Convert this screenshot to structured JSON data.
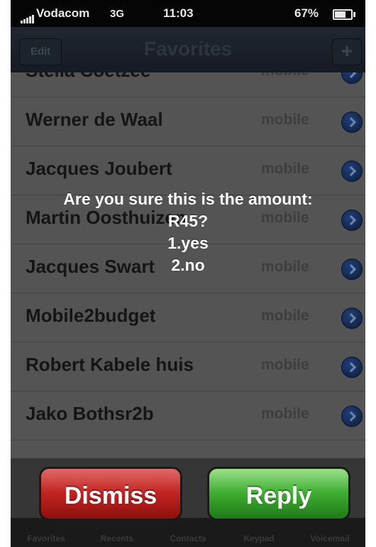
{
  "status_bar": {
    "carrier": "Vodacom",
    "network": "3G",
    "time": "11:03",
    "battery": "67%"
  },
  "nav": {
    "edit_label": "Edit",
    "title": "Favorites",
    "add_label": "+"
  },
  "contacts": [
    {
      "name": "Stella Coetzee",
      "type": "mobile"
    },
    {
      "name": "Werner de Waal",
      "type": "mobile"
    },
    {
      "name": "Jacques Joubert",
      "type": "mobile"
    },
    {
      "name": "Martin Oosthuizen",
      "type": "mobile"
    },
    {
      "name": "Jacques Swart",
      "type": "mobile"
    },
    {
      "name": "Mobile2budget",
      "type": "mobile"
    },
    {
      "name": "Robert Kabele huis",
      "type": "mobile"
    },
    {
      "name": "Jako Bothsr2b",
      "type": "mobile"
    }
  ],
  "alert": {
    "message_lines": [
      "Are you sure this is the amount:",
      "R45?",
      "1.yes",
      "2.no"
    ],
    "dismiss_label": "Dismiss",
    "reply_label": "Reply"
  },
  "tabs": [
    {
      "label": "Favorites"
    },
    {
      "label": "Recents"
    },
    {
      "label": "Contacts"
    },
    {
      "label": "Keypad"
    },
    {
      "label": "Voicemail"
    }
  ],
  "colors": {
    "dismiss": "#c22521",
    "reply": "#3fae32",
    "disclosure": "#1f3f7a"
  }
}
